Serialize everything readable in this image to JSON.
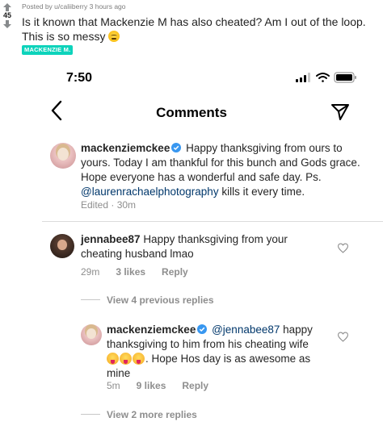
{
  "post": {
    "vote_count": "45",
    "posted_by": "Posted by u/caliiberry 3 hours ago",
    "title": "Is it known that Mackenzie M has also cheated? Am I out of the loop. This is so messy",
    "title_emoji": "grimacing-face",
    "flair": "MACKENZIE M."
  },
  "phone": {
    "status_time": "7:50",
    "nav_title": "Comments",
    "caption": {
      "username": "mackenziemckee",
      "text_1": "Happy thanksgiving from ours to yours. Today I am thankful for this bunch and Gods grace. Hope everyone has a wonderful and safe day. Ps.",
      "mention": "@laurenrachaelphotography",
      "text_2": "kills it every time.",
      "meta": "Edited · 30m"
    },
    "comment": {
      "username": "jennabee87",
      "text": "Happy thanksgiving from your cheating husband lmao",
      "time": "29m",
      "likes": "3 likes",
      "reply": "Reply"
    },
    "view_previous": "View 4 previous replies",
    "reply_comment": {
      "username": "mackenziemckee",
      "mention": "@jennabee87",
      "text_1": "happy thanksgiving to him from his cheating wife",
      "emojis": [
        "winking-face-with-tongue",
        "winking-face-with-tongue",
        "winking-face-with-tongue"
      ],
      "text_2": ". Hope Hos day is as awesome as mine",
      "time": "5m",
      "likes": "9 likes",
      "reply": "Reply"
    },
    "view_more": "View 2 more replies"
  }
}
